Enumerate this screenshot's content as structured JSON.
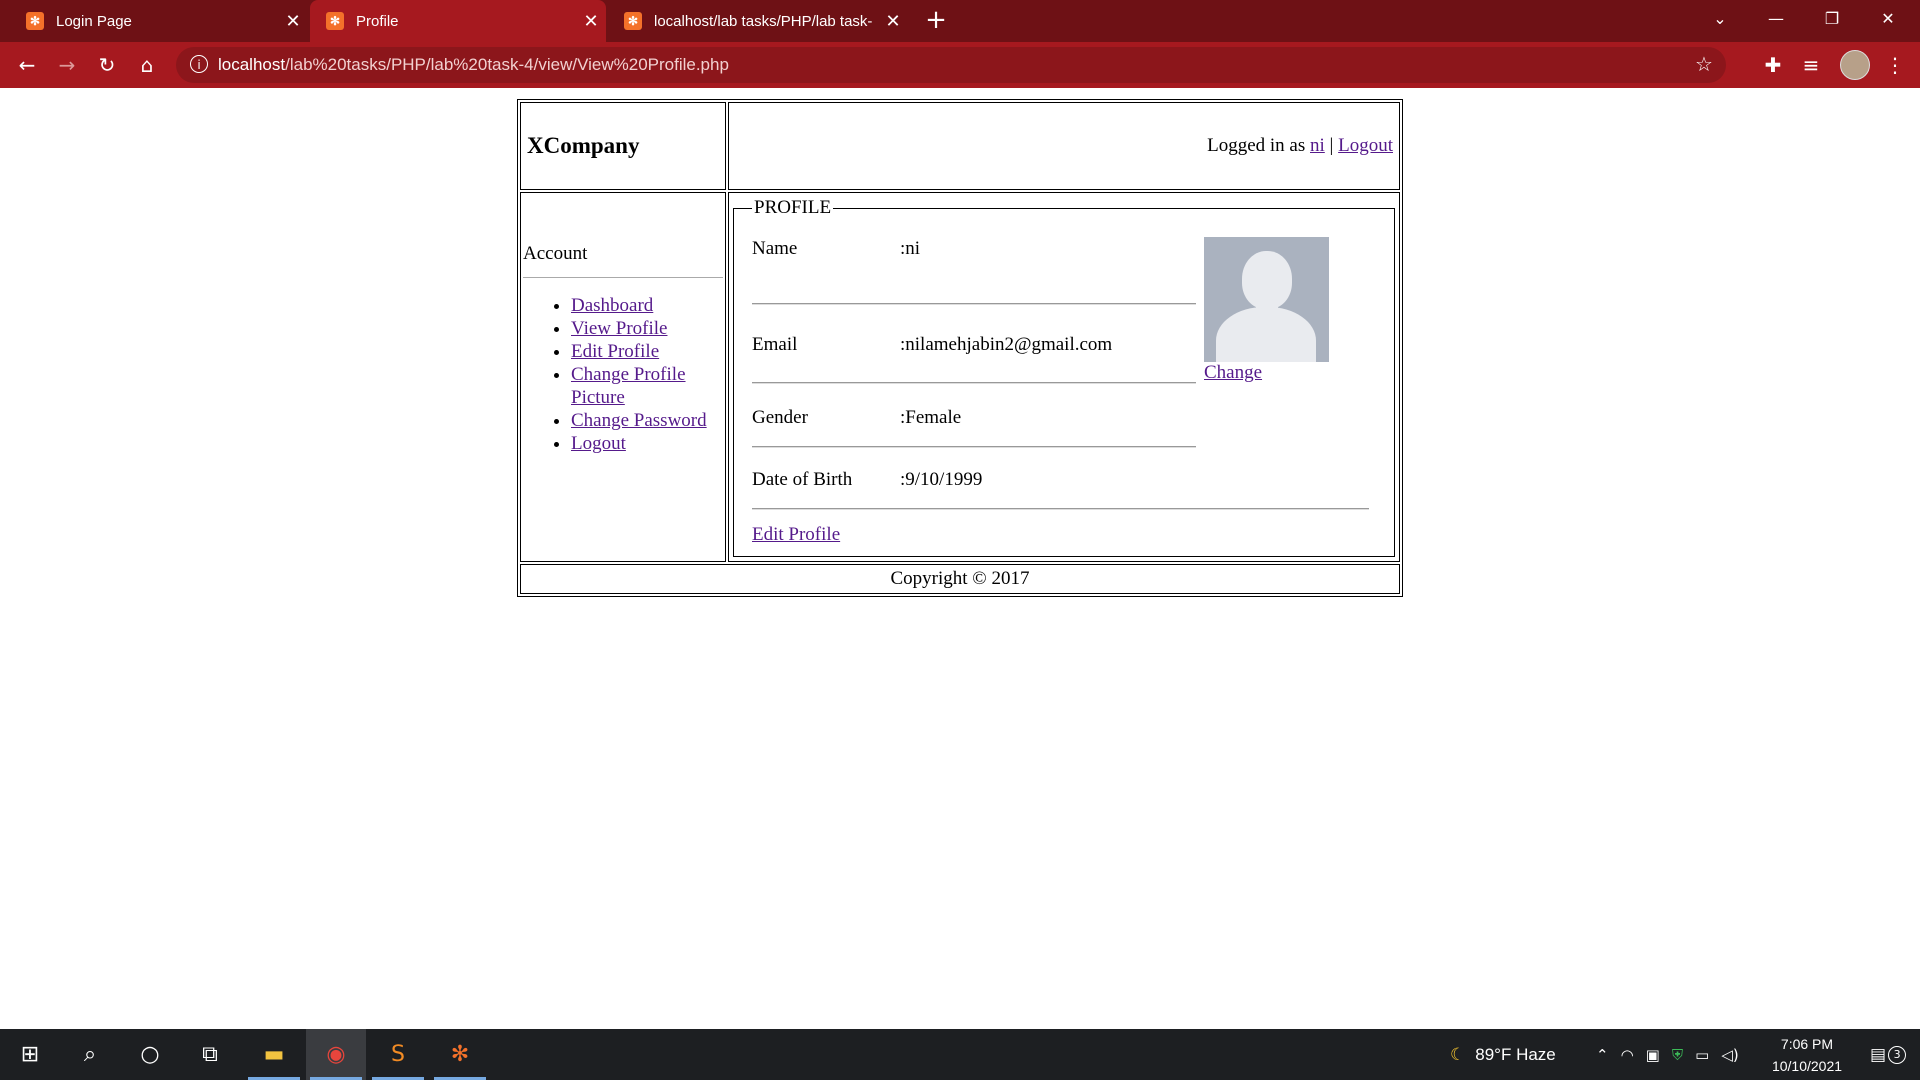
{
  "browser": {
    "tabs": [
      {
        "title": "Login Page",
        "active": false
      },
      {
        "title": "Profile",
        "active": true
      },
      {
        "title": "localhost/lab tasks/PHP/lab task-",
        "active": false
      }
    ],
    "url_host": "localhost",
    "url_path": "/lab%20tasks/PHP/lab%20task-4/view/View%20Profile.php",
    "accent_color": "#a6191f",
    "tabbar_color": "#6e1115"
  },
  "header": {
    "company": "XCompany",
    "logged_in_prefix": "Logged in as ",
    "username": "ni",
    "separator": " | ",
    "logout": "Logout"
  },
  "sidebar": {
    "title": "Account",
    "items": [
      {
        "label": "Dashboard"
      },
      {
        "label": "View Profile"
      },
      {
        "label": "Edit Profile"
      },
      {
        "label": "Change Profile Picture"
      },
      {
        "label": "Change Password"
      },
      {
        "label": "Logout"
      }
    ]
  },
  "profile": {
    "legend": "PROFILE",
    "fields": [
      {
        "label": "Name",
        "value": ":ni"
      },
      {
        "label": "Email",
        "value": ":nilamehjabin2@gmail.com"
      },
      {
        "label": "Gender",
        "value": ":Female"
      },
      {
        "label": "Date of Birth",
        "value": ":9/10/1999"
      }
    ],
    "change_link": "Change",
    "edit_link": "Edit Profile"
  },
  "footer": {
    "copyright": "Copyright © 2017"
  },
  "taskbar": {
    "weather": "89°F  Haze",
    "time": "7:06 PM",
    "date": "10/10/2021",
    "notifications": "3"
  }
}
